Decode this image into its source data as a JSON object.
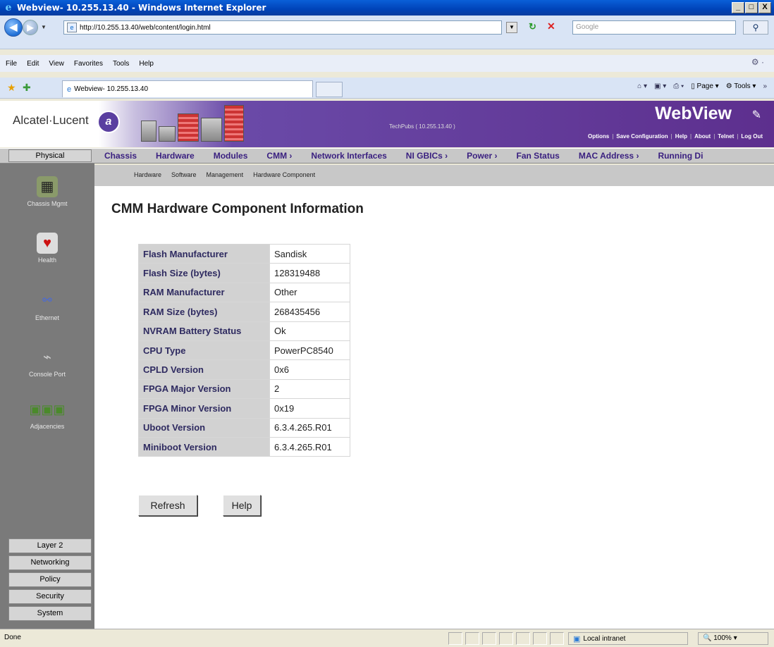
{
  "window": {
    "title": "Webview- 10.255.13.40 - Windows Internet Explorer",
    "controls": [
      "_",
      "□",
      "X"
    ]
  },
  "browser": {
    "url": "http://10.255.13.40/web/content/login.html",
    "search_placeholder": "Google",
    "menu": [
      "File",
      "Edit",
      "View",
      "Favorites",
      "Tools",
      "Help"
    ],
    "tab_title": "Webview- 10.255.13.40",
    "commands": {
      "page": "Page",
      "tools": "Tools"
    },
    "status": "Done",
    "zone": "Local intranet",
    "zoom": "100%"
  },
  "header": {
    "brand": "Alcatel·Lucent",
    "app_title": "WebView",
    "host_label": "TechPubs  ( 10.255.13.40 )",
    "links": [
      "Options",
      "Save Configuration",
      "Help",
      "About",
      "Telnet",
      "Log Out"
    ]
  },
  "nav": {
    "physical": "Physical",
    "items": [
      {
        "label": "Chassis",
        "arrow": false
      },
      {
        "label": "Hardware",
        "arrow": false
      },
      {
        "label": "Modules",
        "arrow": false
      },
      {
        "label": "CMM",
        "arrow": true
      },
      {
        "label": "Network Interfaces",
        "arrow": false
      },
      {
        "label": "NI GBICs",
        "arrow": true
      },
      {
        "label": "Power",
        "arrow": true
      },
      {
        "label": "Fan Status",
        "arrow": false
      },
      {
        "label": "MAC Address",
        "arrow": true
      },
      {
        "label": "Running Di",
        "arrow": false
      }
    ],
    "subitems": [
      "Hardware",
      "Software",
      "Management",
      "Hardware Component"
    ]
  },
  "sidebar": {
    "items": [
      {
        "label": "Chassis Mgmt",
        "icon": "chassis-icon"
      },
      {
        "label": "Health",
        "icon": "health-icon"
      },
      {
        "label": "Ethernet",
        "icon": "ethernet-icon"
      },
      {
        "label": "Console Port",
        "icon": "console-icon"
      },
      {
        "label": "Adjacencies",
        "icon": "adjacencies-icon"
      }
    ],
    "lower": [
      "Layer 2",
      "Networking",
      "Policy",
      "Security",
      "System"
    ]
  },
  "main": {
    "title": "CMM Hardware Component Information",
    "rows": [
      {
        "key": "Flash Manufacturer",
        "value": "Sandisk"
      },
      {
        "key": "Flash Size (bytes)",
        "value": "128319488"
      },
      {
        "key": "RAM Manufacturer",
        "value": "Other"
      },
      {
        "key": "RAM Size (bytes)",
        "value": "268435456"
      },
      {
        "key": "NVRAM Battery Status",
        "value": "Ok"
      },
      {
        "key": "CPU Type",
        "value": "PowerPC8540"
      },
      {
        "key": "CPLD Version",
        "value": "0x6"
      },
      {
        "key": "FPGA Major Version",
        "value": "2"
      },
      {
        "key": "FPGA Minor Version",
        "value": "0x19"
      },
      {
        "key": "Uboot Version",
        "value": "6.3.4.265.R01"
      },
      {
        "key": "Miniboot Version",
        "value": "6.3.4.265.R01"
      }
    ],
    "buttons": {
      "refresh": "Refresh",
      "help": "Help"
    }
  },
  "colors": {
    "header_purple": "#5d2f8e",
    "nav_text": "#3a2080",
    "sidebar_gray": "#7a7a7a",
    "key_cell_bg": "#d2d2d2"
  }
}
